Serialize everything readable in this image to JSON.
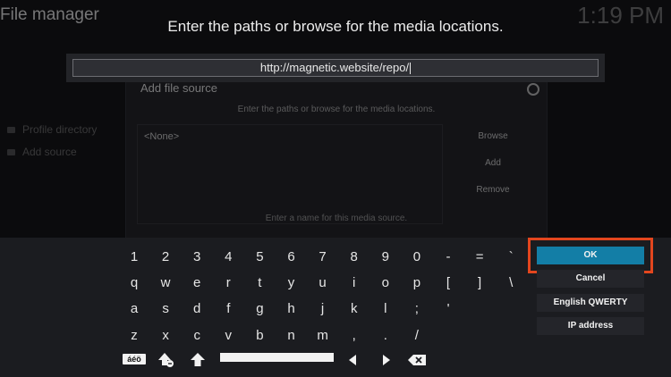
{
  "background": {
    "app_title": "File manager",
    "clock": "1:19 PM",
    "sidebar": [
      "Profile directory",
      "Add source"
    ],
    "dialog": {
      "title": "Add file source",
      "subtitle": "Enter the paths or browse for the media locations.",
      "path_value": "<None>",
      "buttons": [
        "Browse",
        "Add",
        "Remove"
      ],
      "name_hint": "Enter a name for this media source."
    }
  },
  "prompt": "Enter the paths or browse for the media locations.",
  "input": {
    "value": "http://magnetic.website/repo/"
  },
  "keyboard": {
    "rows": [
      [
        "1",
        "2",
        "3",
        "4",
        "5",
        "6",
        "7",
        "8",
        "9",
        "0",
        "-",
        "=",
        "`"
      ],
      [
        "q",
        "w",
        "e",
        "r",
        "t",
        "y",
        "u",
        "i",
        "o",
        "p",
        "[",
        "]",
        "\\"
      ],
      [
        "a",
        "s",
        "d",
        "f",
        "g",
        "h",
        "j",
        "k",
        "l",
        ";",
        "'"
      ],
      [
        "z",
        "x",
        "c",
        "v",
        "b",
        "n",
        "m",
        ",",
        ".",
        "/"
      ]
    ],
    "special_keys": {
      "symbols_label": "áéö",
      "shift": "shift-icon",
      "caps": "caps-lock-icon",
      "left": "arrow-left-icon",
      "right": "arrow-right-icon",
      "backspace": "backspace-icon"
    }
  },
  "actions": {
    "ok": "OK",
    "cancel": "Cancel",
    "layout": "English QWERTY",
    "ip": "IP address"
  },
  "colors": {
    "accent": "#137ea6",
    "highlight": "#e3461e",
    "panel": "#1b1c20"
  }
}
